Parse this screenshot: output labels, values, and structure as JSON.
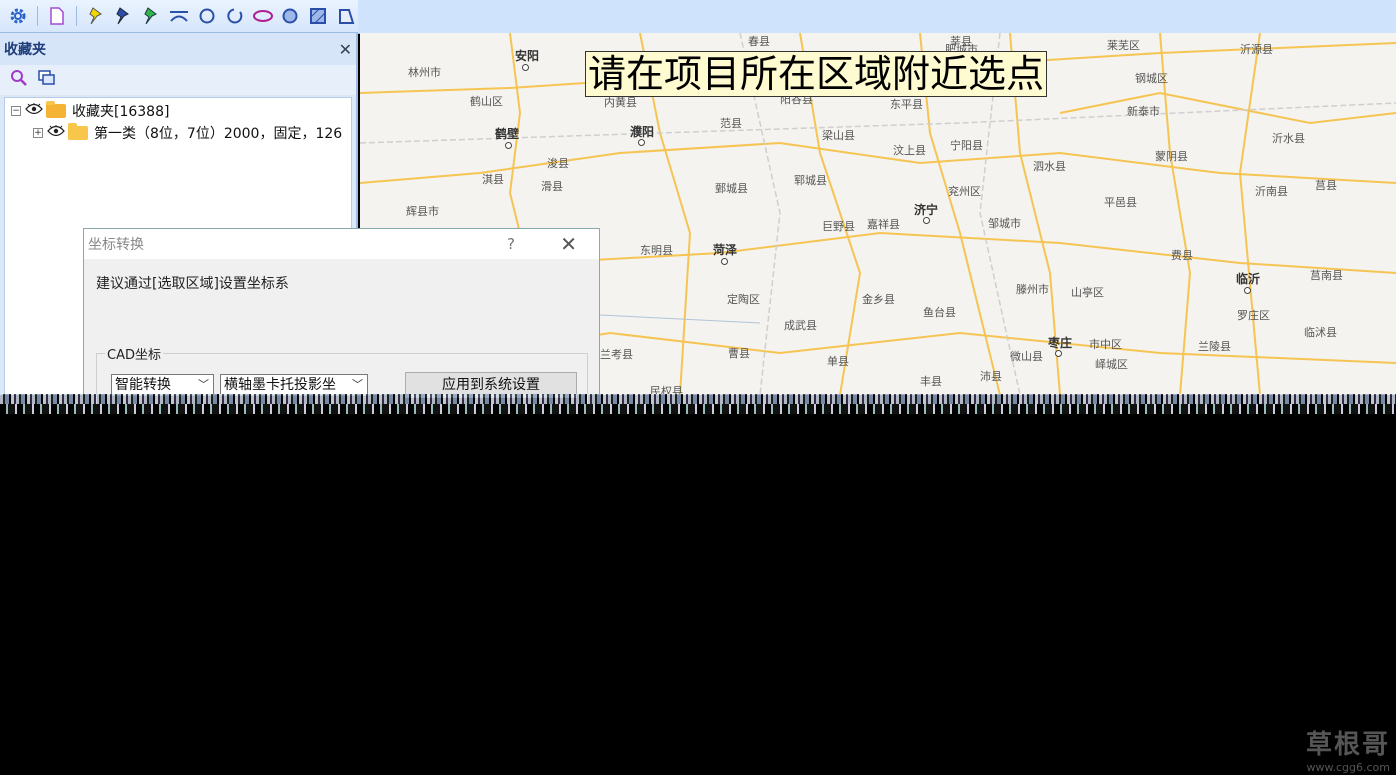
{
  "toolbar": {
    "icons": [
      "gear-icon",
      "page-icon",
      "pin-yellow-icon",
      "pin-blue-icon",
      "pin-green-icon",
      "arc-icon",
      "circle-icon",
      "open-circle-icon",
      "ellipse-icon",
      "filled-circle-icon",
      "hatched-square-icon",
      "polygon-icon"
    ]
  },
  "panel": {
    "title": "收藏夹",
    "close": "✕",
    "tree": {
      "root_label": "收藏夹[16388]",
      "child_label": "第一类（8位，7位）2000，固定，126"
    }
  },
  "map": {
    "hint": "请在项目所在区域附近选点",
    "cities": [
      {
        "name": "安阳",
        "big": true
      },
      {
        "name": "林州市"
      },
      {
        "name": "鹤山区"
      },
      {
        "name": "鹤壁",
        "big": true
      },
      {
        "name": "淇县"
      },
      {
        "name": "浚县"
      },
      {
        "name": "滑县"
      },
      {
        "name": "辉县市"
      },
      {
        "name": "濮阳",
        "big": true
      },
      {
        "name": "内黄县"
      },
      {
        "name": "范县"
      },
      {
        "name": "梁山县"
      },
      {
        "name": "东平县"
      },
      {
        "name": "汶上县"
      },
      {
        "name": "宁阳县"
      },
      {
        "name": "郓城县"
      },
      {
        "name": "鄄城县"
      },
      {
        "name": "兖州区"
      },
      {
        "name": "济宁",
        "big": true
      },
      {
        "name": "嘉祥县"
      },
      {
        "name": "巨野县"
      },
      {
        "name": "菏泽",
        "big": true
      },
      {
        "name": "东明县"
      },
      {
        "name": "定陶区"
      },
      {
        "name": "成武县"
      },
      {
        "name": "金乡县"
      },
      {
        "name": "鱼台县"
      },
      {
        "name": "单县"
      },
      {
        "name": "曹县"
      },
      {
        "name": "丰县"
      },
      {
        "name": "沛县"
      },
      {
        "name": "邹城市"
      },
      {
        "name": "滕州市"
      },
      {
        "name": "微山县"
      },
      {
        "name": "枣庄",
        "big": true
      },
      {
        "name": "市中区"
      },
      {
        "name": "峄城区"
      },
      {
        "name": "山亭区"
      },
      {
        "name": "泗水县"
      },
      {
        "name": "平邑县"
      },
      {
        "name": "费县"
      },
      {
        "name": "新泰市"
      },
      {
        "name": "蒙阴县"
      },
      {
        "name": "沂水县"
      },
      {
        "name": "沂南县"
      },
      {
        "name": "莒县"
      },
      {
        "name": "莒南县"
      },
      {
        "name": "临沂",
        "big": true
      },
      {
        "name": "罗庄区"
      },
      {
        "name": "兰陵县"
      },
      {
        "name": "临沭县"
      },
      {
        "name": "沂源县"
      },
      {
        "name": "莱芜区"
      },
      {
        "name": "钢城区"
      },
      {
        "name": "肥城市"
      },
      {
        "name": "阳谷县"
      },
      {
        "name": "民权县"
      },
      {
        "name": "兰考县"
      },
      {
        "name": "春县"
      },
      {
        "name": "莘县"
      }
    ]
  },
  "dialog": {
    "title": "坐标转换",
    "help": "?",
    "close": "✕",
    "message": "建议通过[选取区域]设置坐标系",
    "group_label": "CAD坐标",
    "combo1": "智能转换",
    "combo2": "横轴墨卡托投影坐",
    "apply_button": "应用到系统设置"
  },
  "watermark": {
    "title": "草根哥",
    "url": "www.cgg6.com"
  }
}
